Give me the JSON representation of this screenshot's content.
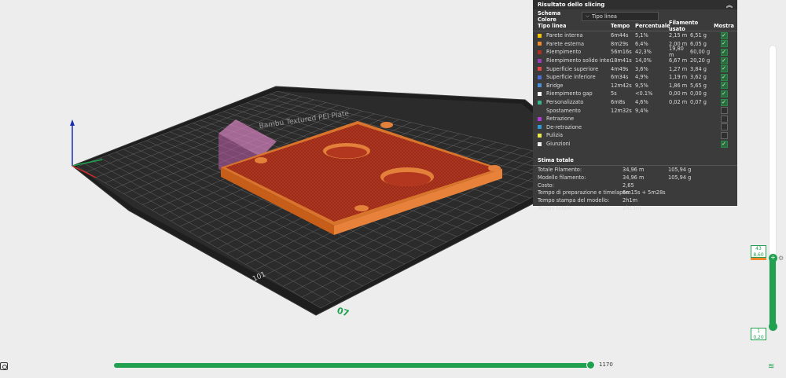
{
  "panel": {
    "title": "Risultato dello slicing",
    "collapse_icon": "chevron-up-icon",
    "scheme_label": "Schema Colore",
    "scheme_value": "Tipo linea",
    "headers": [
      "Tipo linea",
      "Tempo",
      "Percentuale",
      "Filamento usato",
      "Mostra"
    ],
    "rows": [
      {
        "name": "Parete interna",
        "time": "6m44s",
        "pct": "5,1%",
        "len": "2,15 m",
        "wt": "6,51 g",
        "color": "#f5c400",
        "show": true
      },
      {
        "name": "Parete esterna",
        "time": "8m29s",
        "pct": "6,4%",
        "len": "2,00 m",
        "wt": "6,05 g",
        "color": "#f08a2c",
        "show": true
      },
      {
        "name": "Riempimento",
        "time": "56m16s",
        "pct": "42,3%",
        "len": "19,80 m",
        "wt": "60,00 g",
        "color": "#b03022",
        "show": true
      },
      {
        "name": "Riempimento solido interno",
        "time": "18m41s",
        "pct": "14,0%",
        "len": "6,67 m",
        "wt": "20,20 g",
        "color": "#9a3fb5",
        "show": true
      },
      {
        "name": "Superficie superiore",
        "time": "4m49s",
        "pct": "3,6%",
        "len": "1,27 m",
        "wt": "3,84 g",
        "color": "#e64646",
        "show": true
      },
      {
        "name": "Superficie inferiore",
        "time": "6m34s",
        "pct": "4,9%",
        "len": "1,19 m",
        "wt": "3,62 g",
        "color": "#4b6fd6",
        "show": true
      },
      {
        "name": "Bridge",
        "time": "12m42s",
        "pct": "9,5%",
        "len": "1,86 m",
        "wt": "5,65 g",
        "color": "#4a90d9",
        "show": true
      },
      {
        "name": "Riempimento gap",
        "time": "5s",
        "pct": "<0.1%",
        "len": "0,00 m",
        "wt": "0,00 g",
        "color": "#ffffff",
        "show": true
      },
      {
        "name": "Personalizzato",
        "time": "6m8s",
        "pct": "4,6%",
        "len": "0,02 m",
        "wt": "0,07 g",
        "color": "#38b38a",
        "show": true
      },
      {
        "name": "Spostamento",
        "time": "12m32s",
        "pct": "9,4%",
        "len": "",
        "wt": "",
        "color": "#3b3b3b",
        "show": false
      },
      {
        "name": "Retrazione",
        "time": "",
        "pct": "",
        "len": "",
        "wt": "",
        "color": "#b23ad6",
        "show": false
      },
      {
        "name": "De-retrazione",
        "time": "",
        "pct": "",
        "len": "",
        "wt": "",
        "color": "#2e9bd6",
        "show": false
      },
      {
        "name": "Pulizia",
        "time": "",
        "pct": "",
        "len": "",
        "wt": "",
        "color": "#e9e94b",
        "show": false
      },
      {
        "name": "Giunzioni",
        "time": "",
        "pct": "",
        "len": "",
        "wt": "",
        "color": "#f0f0f0",
        "show": true
      }
    ],
    "estimate_title": "Stima totale",
    "estimates": [
      {
        "k": "Totale Filamento:",
        "v1": "34,96 m",
        "v2": "105,94 g"
      },
      {
        "k": "Modello filamento:",
        "v1": "34,96 m",
        "v2": "105,94 g"
      },
      {
        "k": "Costo:",
        "v1": "2,65",
        "v2": ""
      },
      {
        "k": "Tempo di preparazione e timelapse:",
        "v1": "6m15s + 5m28s",
        "v2": ""
      },
      {
        "k": "Tempo stampa del modello:",
        "v1": "2h1m",
        "v2": ""
      },
      {
        "k": "Tempo totale:",
        "v1": "2h13m",
        "v2": ""
      }
    ]
  },
  "viewport": {
    "bed_label": "07",
    "bed_text_front": "101",
    "bed_text_back": "Bambu Textured PEI Plate"
  },
  "layers": {
    "top_number": "43",
    "top_height": "8,60",
    "bottom_number": "1",
    "bottom_height": "0,20",
    "top_knob_glyph": "+",
    "settings_icon": "gear-icon"
  },
  "moves": {
    "value": "1170"
  },
  "icons": {
    "bottom_left": "view-reset-icon",
    "bottom_right": "layers-icon"
  },
  "colors": {
    "accent": "#21a150",
    "panel_bg": "#3b3b3b",
    "model_wall": "#f08a2c",
    "model_infill": "#b03022"
  }
}
